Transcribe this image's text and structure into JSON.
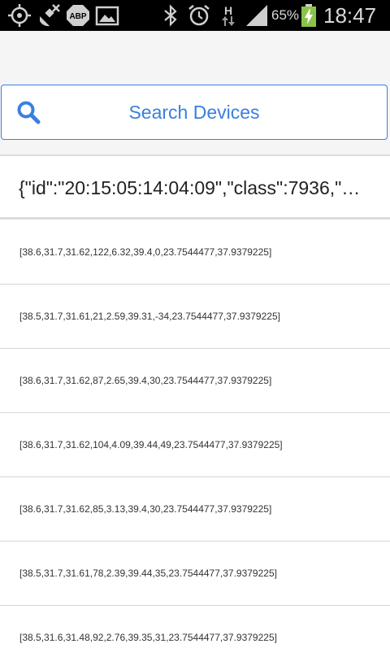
{
  "status_bar": {
    "icons": [
      "gps-icon",
      "satellite-off-icon",
      "adblock-icon",
      "image-icon",
      "bluetooth-icon",
      "alarm-icon",
      "network-h-icon",
      "signal-icon",
      "battery-charging-icon"
    ],
    "network_type": "H",
    "battery_percent": "65%",
    "time": "18:47",
    "battery_color": "#8bc34a"
  },
  "search": {
    "label": "Search Devices",
    "icon": "search-icon",
    "accent_color": "#3a7fe0"
  },
  "device": {
    "header_text": "{\"id\":\"20:15:05:14:04:09\",\"class\":7936,\"…"
  },
  "rows": [
    "[38.6,31.7,31.62,122,6.32,39.4,0,23.7544477,37.9379225]",
    "[38.5,31.7,31.61,21,2.59,39.31,-34,23.7544477,37.9379225]",
    "[38.6,31.7,31.62,87,2.65,39.4,30,23.7544477,37.9379225]",
    "[38.6,31.7,31.62,104,4.09,39.44,49,23.7544477,37.9379225]",
    "[38.6,31.7,31.62,85,3.13,39.4,30,23.7544477,37.9379225]",
    "[38.5,31.7,31.61,78,2.39,39.44,35,23.7544477,37.9379225]",
    "[38.5,31.6,31.48,92,2.76,39.35,31,23.7544477,37.9379225]"
  ]
}
